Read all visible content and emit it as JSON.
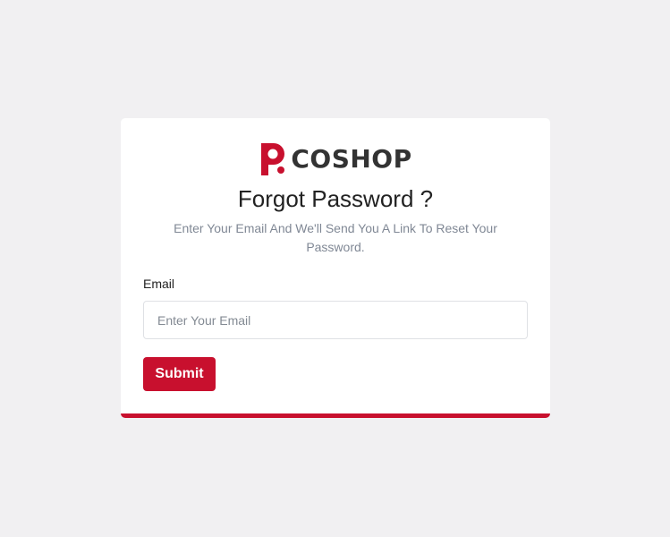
{
  "brand": {
    "name": "COSHOP",
    "logo_icon": "coshop-logo-icon",
    "accent_color": "#c8102e"
  },
  "form": {
    "title": "Forgot Password ?",
    "subtitle": "Enter Your Email And We'll Send You A Link To Reset Your Password.",
    "email_label": "Email",
    "email_value": "",
    "email_placeholder": "Enter Your Email",
    "submit_label": "Submit"
  }
}
